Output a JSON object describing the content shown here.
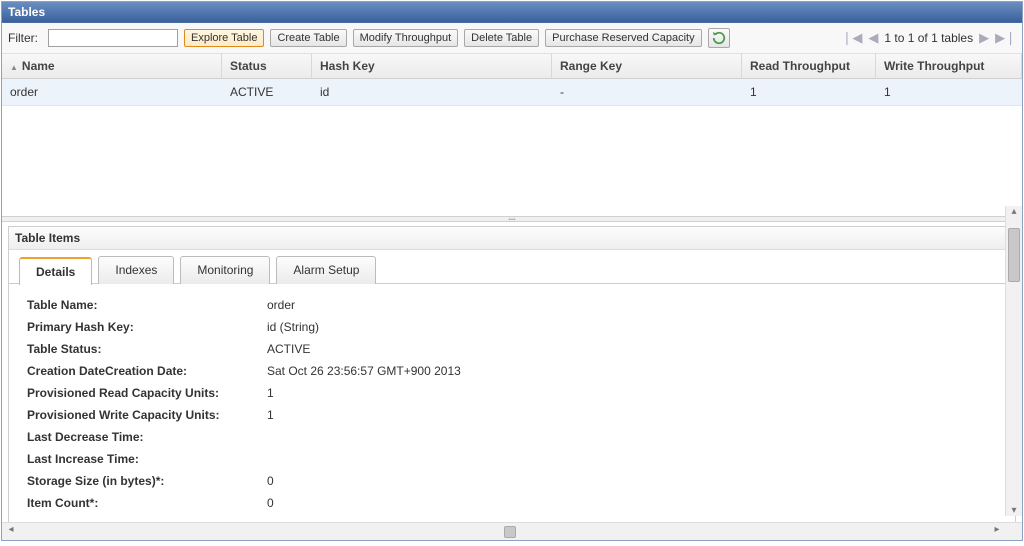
{
  "header": {
    "title": "Tables"
  },
  "toolbar": {
    "filter_label": "Filter:",
    "filter_value": "",
    "explore": "Explore Table",
    "create": "Create Table",
    "modify": "Modify Throughput",
    "delete": "Delete Table",
    "purchase": "Purchase Reserved Capacity"
  },
  "pager": {
    "text": "1 to 1 of 1 tables"
  },
  "columns": {
    "name": "Name",
    "status": "Status",
    "hash": "Hash Key",
    "range": "Range Key",
    "read": "Read Throughput",
    "write": "Write Throughput"
  },
  "rows": [
    {
      "name": "order",
      "status": "ACTIVE",
      "hash": "id",
      "range": "-",
      "read": "1",
      "write": "1"
    }
  ],
  "sub": {
    "title": "Table Items",
    "tabs": {
      "details": "Details",
      "indexes": "Indexes",
      "monitoring": "Monitoring",
      "alarm": "Alarm Setup"
    }
  },
  "details": {
    "labels": {
      "table_name": "Table Name:",
      "primary_hash": "Primary Hash Key:",
      "table_status": "Table Status:",
      "creation": "Creation DateCreation Date:",
      "read_units": "Provisioned Read Capacity Units:",
      "write_units": "Provisioned Write Capacity Units:",
      "last_decrease": "Last Decrease Time:",
      "last_increase": "Last Increase Time:",
      "storage": "Storage Size (in bytes)*:",
      "item_count": "Item Count*:"
    },
    "values": {
      "table_name": "order",
      "primary_hash": "id (String)",
      "table_status": "ACTIVE",
      "creation": "Sat Oct 26 23:56:57 GMT+900 2013",
      "read_units": "1",
      "write_units": "1",
      "last_decrease": "",
      "last_increase": "",
      "storage": "0",
      "item_count": "0"
    }
  }
}
